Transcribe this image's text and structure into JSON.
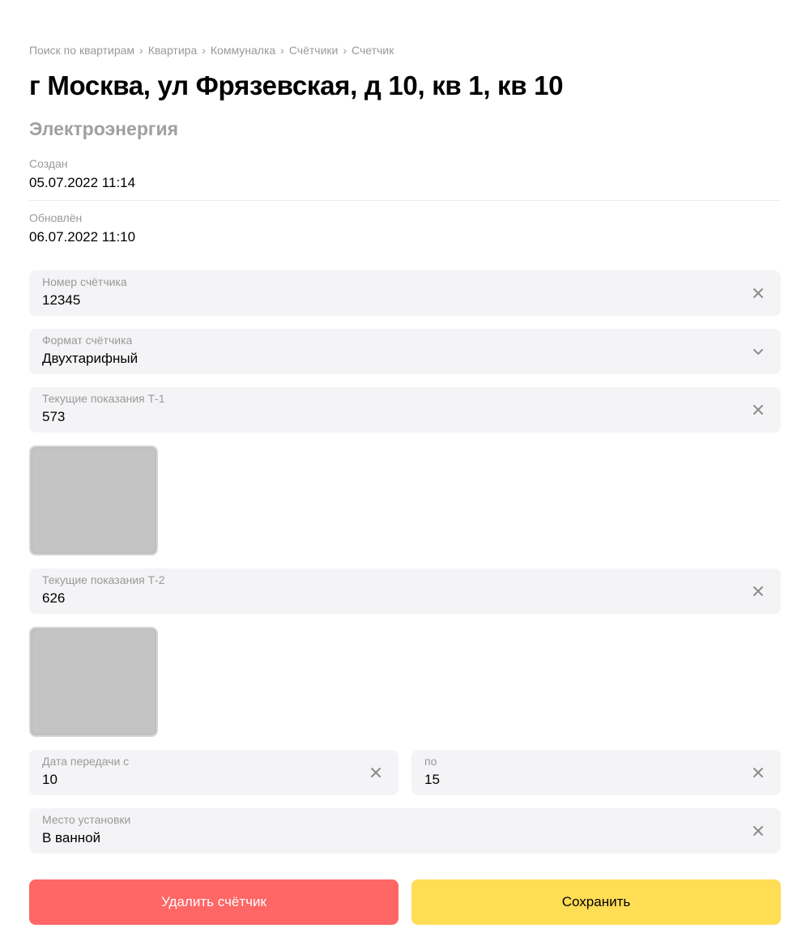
{
  "breadcrumb": [
    "Поиск по квартирам",
    "Квартира",
    "Коммуналка",
    "Счётчики",
    "Счетчик"
  ],
  "breadcrumb_separator": "›",
  "page": {
    "title": "г Москва, ул Фрязевская, д 10, кв 1, кв 10",
    "subtitle": "Электроэнергия"
  },
  "meta": {
    "created_label": "Создан",
    "created_value": "05.07.2022 11:14",
    "updated_label": "Обновлён",
    "updated_value": "06.07.2022 11:10"
  },
  "fields": {
    "meter_number": {
      "label": "Номер счётчика",
      "value": "12345",
      "icon": "close-icon"
    },
    "meter_format": {
      "label": "Формат счётчика",
      "value": "Двухтарифный",
      "icon": "chevron-down-icon"
    },
    "reading_t1": {
      "label": "Текущие показания Т-1",
      "value": "573",
      "icon": "close-icon"
    },
    "reading_t2": {
      "label": "Текущие показания Т-2",
      "value": "626",
      "icon": "close-icon"
    },
    "date_from": {
      "label": "Дата передачи с",
      "value": "10",
      "icon": "close-icon"
    },
    "date_to": {
      "label": "по",
      "value": "15",
      "icon": "close-icon"
    },
    "install_place": {
      "label": "Место установки",
      "value": "В ванной",
      "icon": "close-icon"
    }
  },
  "actions": {
    "delete_label": "Удалить счётчик",
    "save_label": "Сохранить"
  },
  "colors": {
    "field_bg": "#f4f4f6",
    "delete_button": "#ff6666",
    "save_button": "#ffdd55",
    "muted_text": "#999999",
    "photo_placeholder": "#c4c4c4"
  }
}
